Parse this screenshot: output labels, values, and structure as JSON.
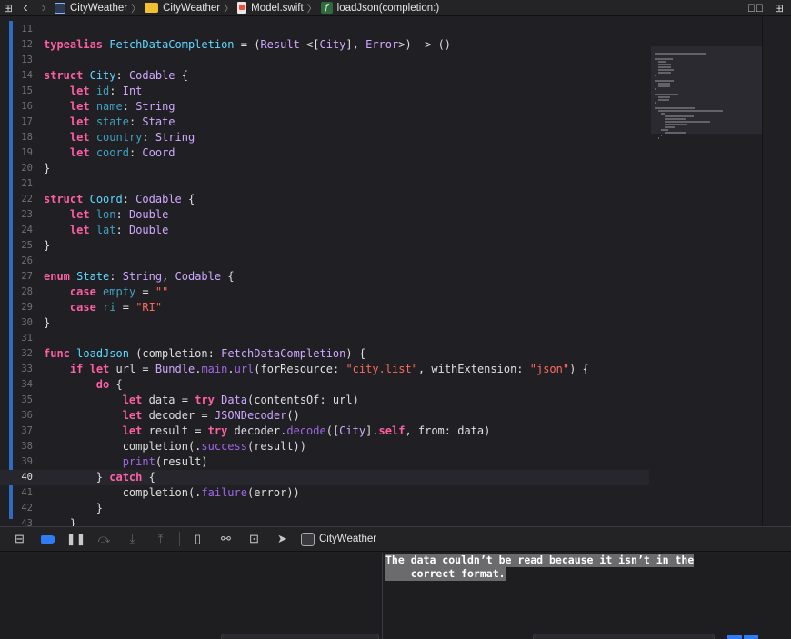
{
  "jumpbar": {
    "crumbs": [
      {
        "label": "CityWeather",
        "icon": "project-icon"
      },
      {
        "label": "CityWeather",
        "icon": "folder-icon"
      },
      {
        "label": "Model.swift",
        "icon": "swift-file-icon"
      },
      {
        "label": "loadJson(completion:)",
        "icon": "function-icon"
      }
    ]
  },
  "editor": {
    "current_line": "40",
    "lines": [
      {
        "n": "11",
        "tokens": []
      },
      {
        "n": "12",
        "tokens": [
          [
            "kw",
            "typealias"
          ],
          [
            "t",
            " "
          ],
          [
            "dec",
            "FetchDataCompletion"
          ],
          [
            "t",
            " = ("
          ],
          [
            "ty",
            "Result"
          ],
          [
            "t",
            " <["
          ],
          [
            "ty",
            "City"
          ],
          [
            "t",
            "], "
          ],
          [
            "ty",
            "Error"
          ],
          [
            "t",
            ">) -> ()"
          ]
        ]
      },
      {
        "n": "13",
        "tokens": []
      },
      {
        "n": "14",
        "tokens": [
          [
            "kw",
            "struct"
          ],
          [
            "t",
            " "
          ],
          [
            "dec",
            "City"
          ],
          [
            "t",
            ": "
          ],
          [
            "ty",
            "Codable"
          ],
          [
            "t",
            " {"
          ]
        ]
      },
      {
        "n": "15",
        "tokens": [
          [
            "t",
            "    "
          ],
          [
            "kw",
            "let"
          ],
          [
            "t",
            " "
          ],
          [
            "prop",
            "id"
          ],
          [
            "t",
            ": "
          ],
          [
            "ty",
            "Int"
          ]
        ]
      },
      {
        "n": "16",
        "tokens": [
          [
            "t",
            "    "
          ],
          [
            "kw",
            "let"
          ],
          [
            "t",
            " "
          ],
          [
            "prop",
            "name"
          ],
          [
            "t",
            ": "
          ],
          [
            "ty",
            "String"
          ]
        ]
      },
      {
        "n": "17",
        "tokens": [
          [
            "t",
            "    "
          ],
          [
            "kw",
            "let"
          ],
          [
            "t",
            " "
          ],
          [
            "prop",
            "state"
          ],
          [
            "t",
            ": "
          ],
          [
            "ty",
            "State"
          ]
        ]
      },
      {
        "n": "18",
        "tokens": [
          [
            "t",
            "    "
          ],
          [
            "kw",
            "let"
          ],
          [
            "t",
            " "
          ],
          [
            "prop",
            "country"
          ],
          [
            "t",
            ": "
          ],
          [
            "ty",
            "String"
          ]
        ]
      },
      {
        "n": "19",
        "tokens": [
          [
            "t",
            "    "
          ],
          [
            "kw",
            "let"
          ],
          [
            "t",
            " "
          ],
          [
            "prop",
            "coord"
          ],
          [
            "t",
            ": "
          ],
          [
            "ty",
            "Coord"
          ]
        ]
      },
      {
        "n": "20",
        "tokens": [
          [
            "t",
            "}"
          ]
        ]
      },
      {
        "n": "21",
        "tokens": []
      },
      {
        "n": "22",
        "tokens": [
          [
            "kw",
            "struct"
          ],
          [
            "t",
            " "
          ],
          [
            "dec",
            "Coord"
          ],
          [
            "t",
            ": "
          ],
          [
            "ty",
            "Codable"
          ],
          [
            "t",
            " {"
          ]
        ]
      },
      {
        "n": "23",
        "tokens": [
          [
            "t",
            "    "
          ],
          [
            "kw",
            "let"
          ],
          [
            "t",
            " "
          ],
          [
            "prop",
            "lon"
          ],
          [
            "t",
            ": "
          ],
          [
            "ty",
            "Double"
          ]
        ]
      },
      {
        "n": "24",
        "tokens": [
          [
            "t",
            "    "
          ],
          [
            "kw",
            "let"
          ],
          [
            "t",
            " "
          ],
          [
            "prop",
            "lat"
          ],
          [
            "t",
            ": "
          ],
          [
            "ty",
            "Double"
          ]
        ]
      },
      {
        "n": "25",
        "tokens": [
          [
            "t",
            "}"
          ]
        ]
      },
      {
        "n": "26",
        "tokens": []
      },
      {
        "n": "27",
        "tokens": [
          [
            "kw",
            "enum"
          ],
          [
            "t",
            " "
          ],
          [
            "dec",
            "State"
          ],
          [
            "t",
            ": "
          ],
          [
            "ty",
            "String"
          ],
          [
            "t",
            ", "
          ],
          [
            "ty",
            "Codable"
          ],
          [
            "t",
            " {"
          ]
        ]
      },
      {
        "n": "28",
        "tokens": [
          [
            "t",
            "    "
          ],
          [
            "kw",
            "case"
          ],
          [
            "t",
            " "
          ],
          [
            "prop",
            "empty"
          ],
          [
            "t",
            " = "
          ],
          [
            "str",
            "\"\""
          ]
        ]
      },
      {
        "n": "29",
        "tokens": [
          [
            "t",
            "    "
          ],
          [
            "kw",
            "case"
          ],
          [
            "t",
            " "
          ],
          [
            "prop",
            "ri"
          ],
          [
            "t",
            " = "
          ],
          [
            "str",
            "\"RI\""
          ]
        ]
      },
      {
        "n": "30",
        "tokens": [
          [
            "t",
            "}"
          ]
        ]
      },
      {
        "n": "31",
        "tokens": []
      },
      {
        "n": "32",
        "tokens": [
          [
            "kw",
            "func"
          ],
          [
            "t",
            " "
          ],
          [
            "dec",
            "loadJson"
          ],
          [
            "t",
            " (completion: "
          ],
          [
            "ty",
            "FetchDataCompletion"
          ],
          [
            "t",
            ") {"
          ]
        ]
      },
      {
        "n": "33",
        "tokens": [
          [
            "t",
            "    "
          ],
          [
            "kw",
            "if"
          ],
          [
            "t",
            " "
          ],
          [
            "kw",
            "let"
          ],
          [
            "t",
            " url = "
          ],
          [
            "ty",
            "Bundle"
          ],
          [
            "t",
            "."
          ],
          [
            "fn",
            "main"
          ],
          [
            "t",
            "."
          ],
          [
            "fn",
            "url"
          ],
          [
            "t",
            "(forResource: "
          ],
          [
            "str",
            "\"city.list\""
          ],
          [
            "t",
            ", withExtension: "
          ],
          [
            "str",
            "\"json\""
          ],
          [
            "t",
            ") {"
          ]
        ]
      },
      {
        "n": "34",
        "tokens": [
          [
            "t",
            "        "
          ],
          [
            "kw",
            "do"
          ],
          [
            "t",
            " {"
          ]
        ]
      },
      {
        "n": "35",
        "tokens": [
          [
            "t",
            "            "
          ],
          [
            "kw",
            "let"
          ],
          [
            "t",
            " data = "
          ],
          [
            "kw",
            "try"
          ],
          [
            "t",
            " "
          ],
          [
            "ty",
            "Data"
          ],
          [
            "t",
            "(contentsOf: url)"
          ]
        ]
      },
      {
        "n": "36",
        "tokens": [
          [
            "t",
            "            "
          ],
          [
            "kw",
            "let"
          ],
          [
            "t",
            " decoder = "
          ],
          [
            "ty",
            "JSONDecoder"
          ],
          [
            "t",
            "()"
          ]
        ]
      },
      {
        "n": "37",
        "tokens": [
          [
            "t",
            "            "
          ],
          [
            "kw",
            "let"
          ],
          [
            "t",
            " result = "
          ],
          [
            "kw",
            "try"
          ],
          [
            "t",
            " decoder."
          ],
          [
            "fn",
            "decode"
          ],
          [
            "t",
            "(["
          ],
          [
            "ty",
            "City"
          ],
          [
            "t",
            "]."
          ],
          [
            "kw",
            "self"
          ],
          [
            "t",
            ", from: data)"
          ]
        ]
      },
      {
        "n": "38",
        "tokens": [
          [
            "t",
            "            completion(."
          ],
          [
            "fn",
            "success"
          ],
          [
            "t",
            "(result))"
          ]
        ]
      },
      {
        "n": "39",
        "tokens": [
          [
            "t",
            "            "
          ],
          [
            "fn",
            "print"
          ],
          [
            "t",
            "(result)"
          ]
        ]
      },
      {
        "n": "40",
        "tokens": [
          [
            "t",
            "        } "
          ],
          [
            "kw",
            "catch"
          ],
          [
            "t",
            " {"
          ]
        ]
      },
      {
        "n": "41",
        "tokens": [
          [
            "t",
            "            completion(."
          ],
          [
            "fn",
            "failure"
          ],
          [
            "t",
            "(error))"
          ]
        ]
      },
      {
        "n": "42",
        "tokens": [
          [
            "t",
            "        }"
          ]
        ]
      },
      {
        "n": "43",
        "tokens": [
          [
            "t",
            "    }"
          ]
        ]
      }
    ]
  },
  "debugbar": {
    "target_label": "CityWeather"
  },
  "console": {
    "lines": [
      "The data couldn’t be read because it isn’t in the",
      "    correct format."
    ]
  },
  "colors": {
    "keyword": "#fc5fa3",
    "type": "#d0a8ff",
    "declaration": "#5dd8ff",
    "property": "#41a1c0",
    "function": "#a167e6",
    "string": "#fc6a5d",
    "breakpoint_accent": "#2f7cf6"
  }
}
